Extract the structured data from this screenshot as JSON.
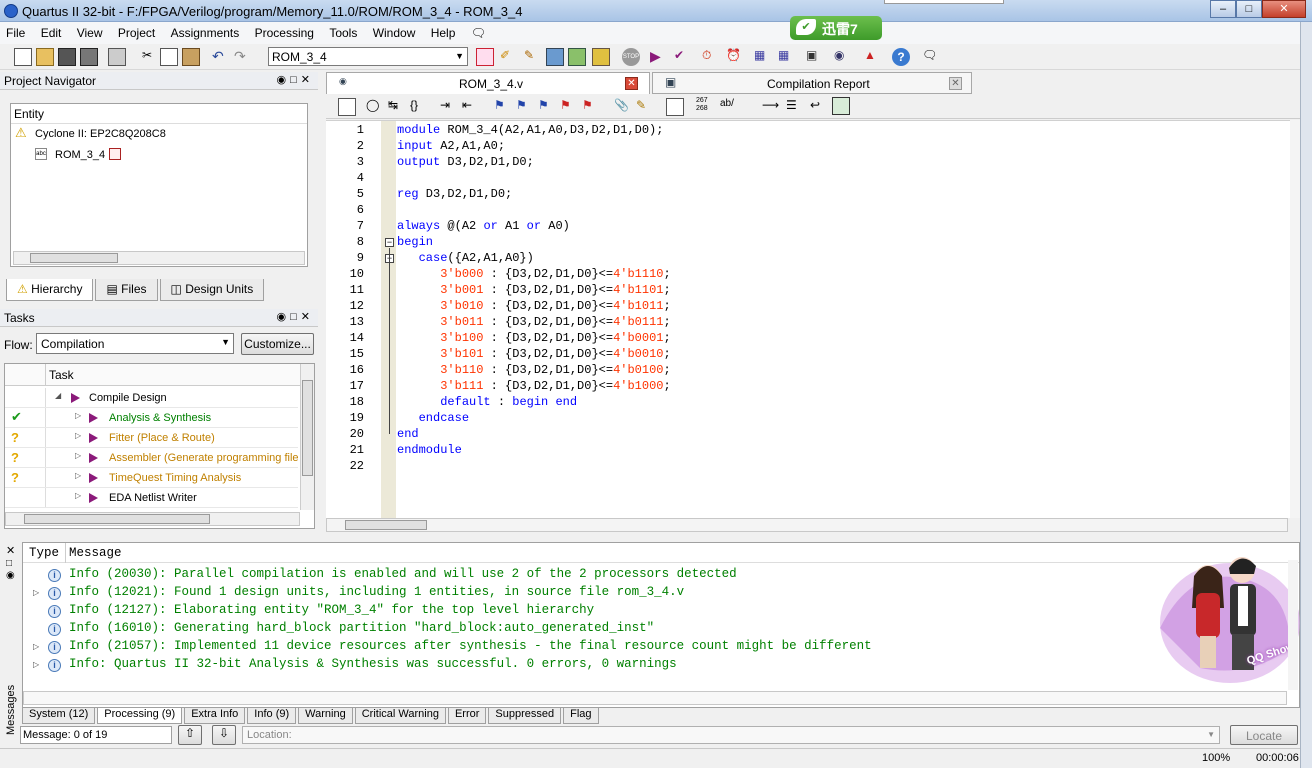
{
  "window": {
    "title": "Quartus II 32-bit - F:/FPGA/Verilog/program/Memory_11.0/ROM/ROM_3_4 - ROM_3_4",
    "min": "–",
    "max": "□",
    "close": "✕"
  },
  "xunlei": {
    "label": "迅雷7",
    "leaf": "✔"
  },
  "menu": [
    "File",
    "Edit",
    "View",
    "Project",
    "Assignments",
    "Processing",
    "Tools",
    "Window",
    "Help"
  ],
  "toolbar": {
    "entity_combo": "ROM_3_4"
  },
  "project_navigator": {
    "title": "Project Navigator",
    "entity_header": "Entity",
    "device": "Cyclone II: EP2C8Q208C8",
    "top_entity": "ROM_3_4",
    "tabs": [
      "Hierarchy",
      "Files",
      "Design Units"
    ]
  },
  "tasks": {
    "title": "Tasks",
    "flow_label": "Flow:",
    "flow_value": "Compilation",
    "customize": "Customize...",
    "column": "Task",
    "rows": [
      {
        "name": "Compile Design",
        "status": "",
        "color": "#000000"
      },
      {
        "name": "Analysis & Synthesis",
        "status": "✔",
        "color": "#008000"
      },
      {
        "name": "Fitter (Place & Route)",
        "status": "?",
        "color": "#c08000"
      },
      {
        "name": "Assembler (Generate programming files)",
        "status": "?",
        "color": "#c08000"
      },
      {
        "name": "TimeQuest Timing Analysis",
        "status": "?",
        "color": "#c08000"
      },
      {
        "name": "EDA Netlist Writer",
        "status": "",
        "color": "#000000"
      }
    ]
  },
  "editor_tabs": [
    {
      "label": "ROM_3_4.v",
      "active": true
    },
    {
      "label": "Compilation Report",
      "active": false
    }
  ],
  "code_lines": [
    [
      [
        "kw",
        "module"
      ],
      [
        "t",
        " ROM_3_4(A2,A1,A0,D3,D2,D1,D0);"
      ]
    ],
    [
      [
        "kw",
        "input"
      ],
      [
        "t",
        " A2,A1,A0;"
      ]
    ],
    [
      [
        "kw",
        "output"
      ],
      [
        "t",
        " D3,D2,D1,D0;"
      ]
    ],
    [],
    [
      [
        "kw",
        "reg"
      ],
      [
        "t",
        " D3,D2,D1,D0;"
      ]
    ],
    [],
    [
      [
        "kw",
        "always"
      ],
      [
        "t",
        " @(A2 "
      ],
      [
        "kw",
        "or"
      ],
      [
        "t",
        " A1 "
      ],
      [
        "kw",
        "or"
      ],
      [
        "t",
        " A0)"
      ]
    ],
    [
      [
        "kw",
        "begin"
      ]
    ],
    [
      [
        "t",
        "   "
      ],
      [
        "kw",
        "case"
      ],
      [
        "t",
        "({A2,A1,A0})"
      ]
    ],
    [
      [
        "t",
        "      "
      ],
      [
        "num",
        "3'b000"
      ],
      [
        "t",
        " : {D3,D2,D1,D0}<="
      ],
      [
        "num",
        "4'b1110"
      ],
      [
        "t",
        ";"
      ]
    ],
    [
      [
        "t",
        "      "
      ],
      [
        "num",
        "3'b001"
      ],
      [
        "t",
        " : {D3,D2,D1,D0}<="
      ],
      [
        "num",
        "4'b1101"
      ],
      [
        "t",
        ";"
      ]
    ],
    [
      [
        "t",
        "      "
      ],
      [
        "num",
        "3'b010"
      ],
      [
        "t",
        " : {D3,D2,D1,D0}<="
      ],
      [
        "num",
        "4'b1011"
      ],
      [
        "t",
        ";"
      ]
    ],
    [
      [
        "t",
        "      "
      ],
      [
        "num",
        "3'b011"
      ],
      [
        "t",
        " : {D3,D2,D1,D0}<="
      ],
      [
        "num",
        "4'b0111"
      ],
      [
        "t",
        ";"
      ]
    ],
    [
      [
        "t",
        "      "
      ],
      [
        "num",
        "3'b100"
      ],
      [
        "t",
        " : {D3,D2,D1,D0}<="
      ],
      [
        "num",
        "4'b0001"
      ],
      [
        "t",
        ";"
      ]
    ],
    [
      [
        "t",
        "      "
      ],
      [
        "num",
        "3'b101"
      ],
      [
        "t",
        " : {D3,D2,D1,D0}<="
      ],
      [
        "num",
        "4'b0010"
      ],
      [
        "t",
        ";"
      ]
    ],
    [
      [
        "t",
        "      "
      ],
      [
        "num",
        "3'b110"
      ],
      [
        "t",
        " : {D3,D2,D1,D0}<="
      ],
      [
        "num",
        "4'b0100"
      ],
      [
        "t",
        ";"
      ]
    ],
    [
      [
        "t",
        "      "
      ],
      [
        "num",
        "3'b111"
      ],
      [
        "t",
        " : {D3,D2,D1,D0}<="
      ],
      [
        "num",
        "4'b1000"
      ],
      [
        "t",
        ";"
      ]
    ],
    [
      [
        "t",
        "      "
      ],
      [
        "kw",
        "default"
      ],
      [
        "t",
        " : "
      ],
      [
        "kw",
        "begin"
      ],
      [
        "t",
        " "
      ],
      [
        "kw",
        "end"
      ]
    ],
    [
      [
        "t",
        "   "
      ],
      [
        "kw",
        "endcase"
      ]
    ],
    [
      [
        "kw",
        "end"
      ]
    ],
    [
      [
        "kw",
        "endmodule"
      ]
    ],
    []
  ],
  "messages": {
    "header_type": "Type",
    "header_message": "Message",
    "lines": [
      {
        "text": "Info (20030): Parallel compilation is enabled and will use 2 of the 2 processors detected",
        "expand": false
      },
      {
        "text": "Info (12021): Found 1 design units, including 1 entities, in source file rom_3_4.v",
        "expand": true
      },
      {
        "text": "Info (12127): Elaborating entity \"ROM_3_4\" for the top level hierarchy",
        "expand": false
      },
      {
        "text": "Info (16010): Generating hard_block partition \"hard_block:auto_generated_inst\"",
        "expand": false
      },
      {
        "text": "Info (21057): Implemented 11 device resources after synthesis - the final resource count might be different",
        "expand": true
      },
      {
        "text": "Info: Quartus II 32-bit Analysis & Synthesis was successful. 0 errors, 0 warnings",
        "expand": true
      }
    ],
    "tabs": [
      "System (12)",
      "Processing (9)",
      "Extra Info",
      "Info (9)",
      "Warning",
      "Critical Warning",
      "Error",
      "Suppressed",
      "Flag"
    ],
    "side_label": "Messages",
    "count": "Message: 0 of 19",
    "location_placeholder": "Location:",
    "locate": "Locate"
  },
  "qqshow": {
    "label": "QQ Show"
  },
  "status": {
    "zoom": "100%",
    "time": "00:00:06"
  }
}
